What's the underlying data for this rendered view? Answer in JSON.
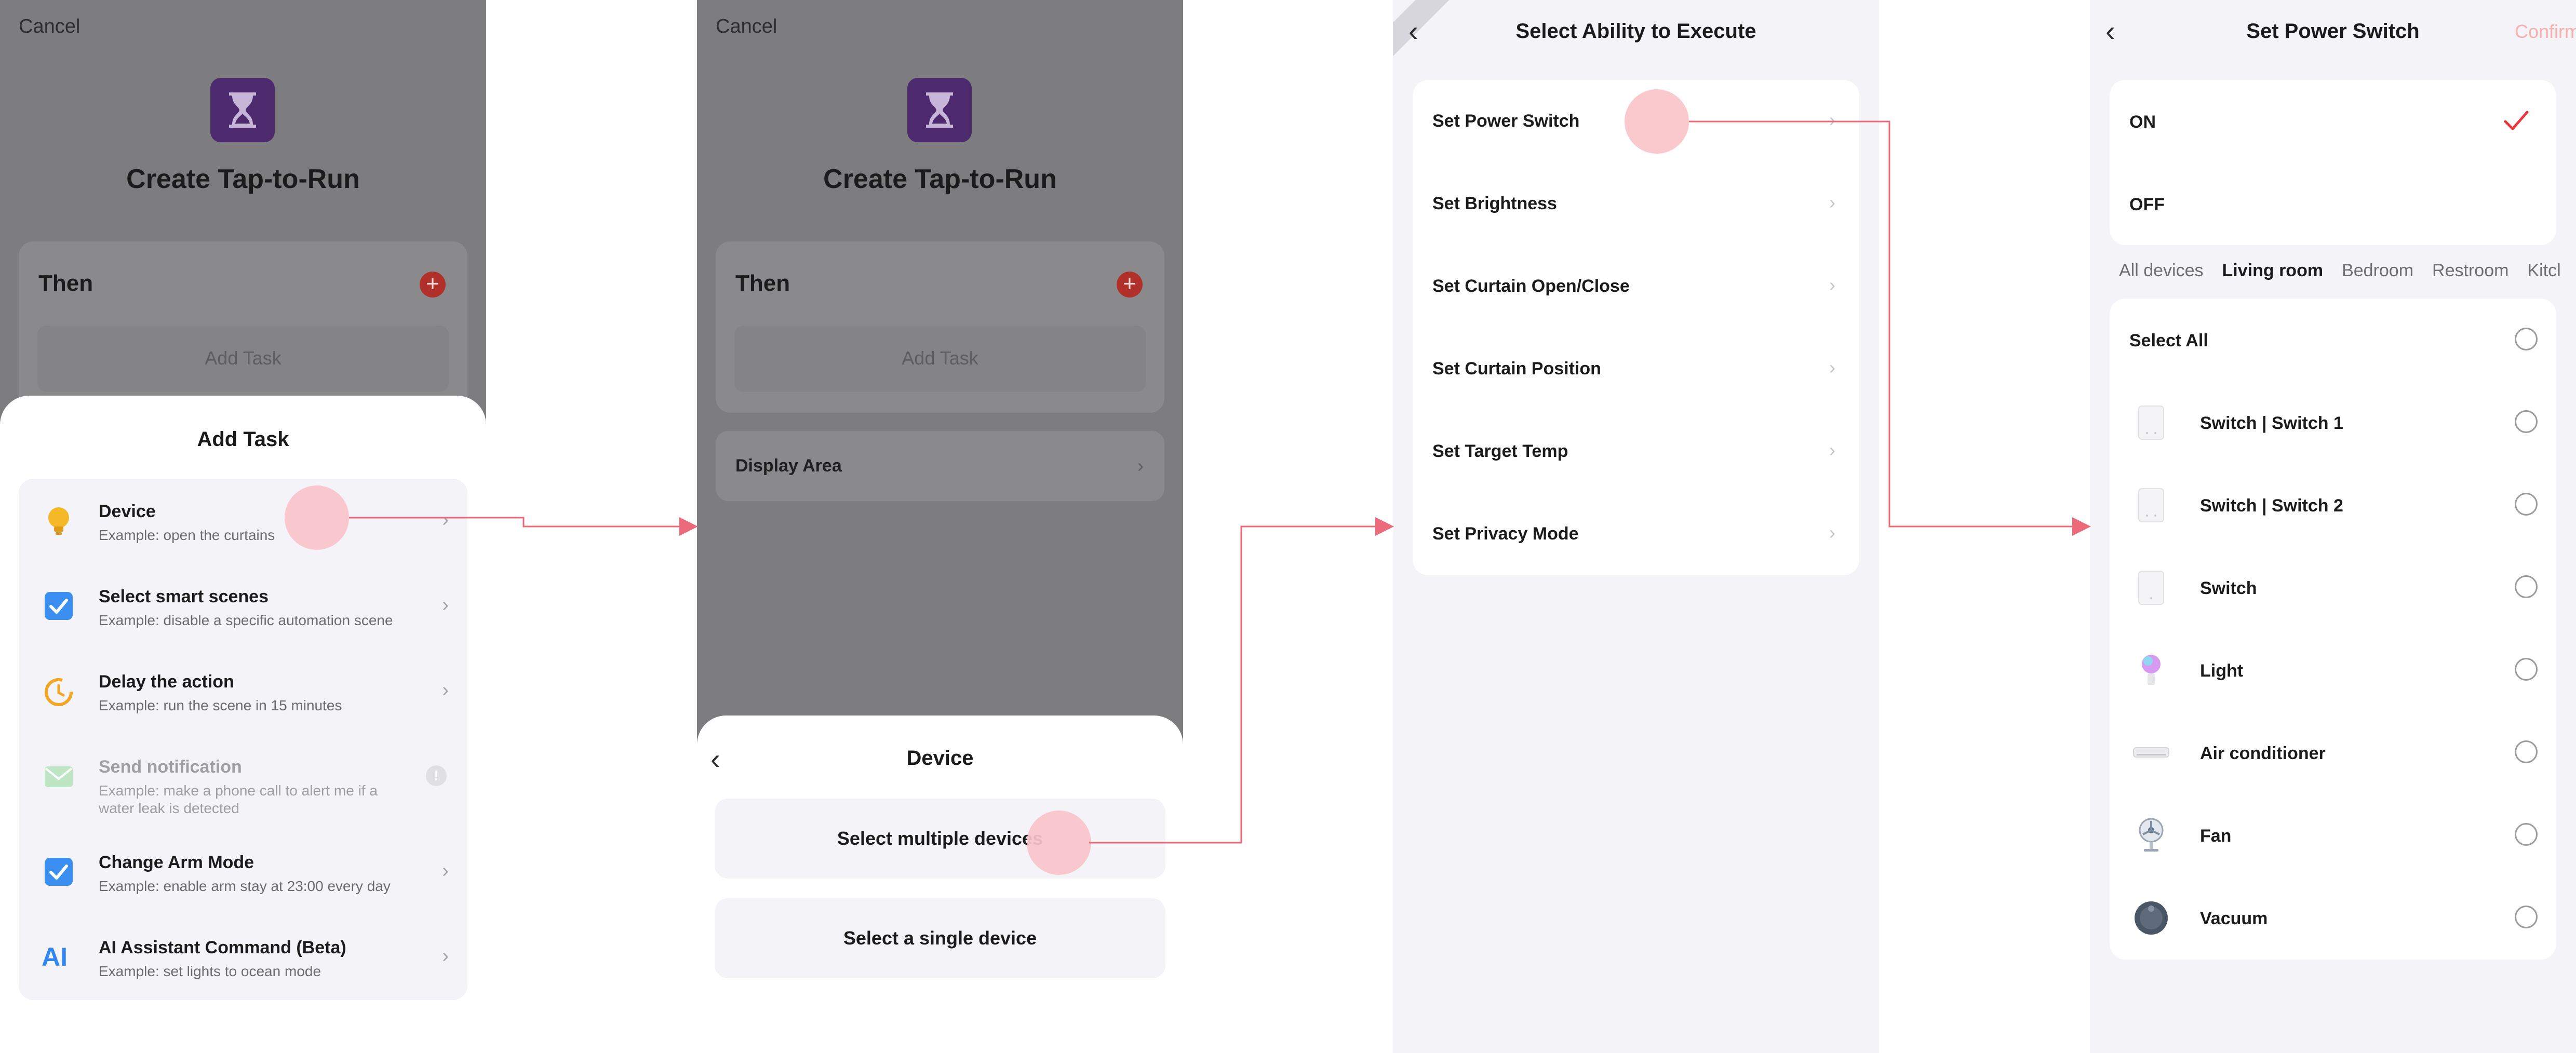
{
  "screen1": {
    "cancel": "Cancel",
    "title": "Create Tap-to-Run",
    "then_label": "Then",
    "add_task_placeholder": "Add Task",
    "sheet": {
      "title": "Add Task",
      "items": [
        {
          "title": "Device",
          "subtitle": "Example: open the curtains",
          "icon": "lightbulb-icon"
        },
        {
          "title": "Select smart scenes",
          "subtitle": "Example: disable a specific automation scene",
          "icon": "checkbox-icon"
        },
        {
          "title": "Delay the action",
          "subtitle": "Example: run the scene in 15 minutes",
          "icon": "timer-icon"
        },
        {
          "title": "Send notification",
          "subtitle": "Example: make a phone call to alert me if a water leak is detected",
          "icon": "envelope-icon",
          "info": "!"
        },
        {
          "title": "Change Arm Mode",
          "subtitle": "Example: enable arm stay at 23:00 every day",
          "icon": "checkbox-icon"
        },
        {
          "title": "AI Assistant Command (Beta)",
          "subtitle": "Example: set lights to ocean mode",
          "icon": "ai-icon",
          "icon_text": "AI"
        }
      ]
    }
  },
  "screen2": {
    "cancel": "Cancel",
    "title": "Create Tap-to-Run",
    "then_label": "Then",
    "add_task_placeholder": "Add Task",
    "display_area": "Display Area",
    "sheet": {
      "title": "Device",
      "options": [
        "Select multiple devices",
        "Select a single device"
      ]
    }
  },
  "screen3": {
    "title": "Select Ability to Execute",
    "abilities": [
      "Set Power Switch",
      "Set Brightness",
      "Set Curtain Open/Close",
      "Set Curtain Position",
      "Set Target Temp",
      "Set Privacy Mode"
    ]
  },
  "screen4": {
    "title": "Set Power Switch",
    "confirm": "Confirm",
    "states": [
      {
        "label": "ON",
        "selected": true
      },
      {
        "label": "OFF",
        "selected": false
      }
    ],
    "tabs": [
      {
        "label": "All devices",
        "active": false
      },
      {
        "label": "Living room",
        "active": true
      },
      {
        "label": "Bedroom",
        "active": false
      },
      {
        "label": "Restroom",
        "active": false
      },
      {
        "label": "Kitcl",
        "active": false
      }
    ],
    "select_all": "Select All",
    "devices": [
      {
        "label": "Switch | Switch 1",
        "icon": "switch-device-icon"
      },
      {
        "label": "Switch | Switch 2",
        "icon": "switch-device-icon"
      },
      {
        "label": "Switch",
        "icon": "switch-device-icon"
      },
      {
        "label": "Light",
        "icon": "bulb-device-icon"
      },
      {
        "label": "Air conditioner",
        "icon": "ac-device-icon"
      },
      {
        "label": "Fan",
        "icon": "fan-device-icon"
      },
      {
        "label": "Vacuum",
        "icon": "vacuum-device-icon"
      }
    ]
  },
  "colors": {
    "accent_red": "#e8383d",
    "touch_pink": "#f9c4ca",
    "connector": "#ec6b7b",
    "dim_overlay": "#7d7d80",
    "page_light": "#f3f3f8"
  }
}
